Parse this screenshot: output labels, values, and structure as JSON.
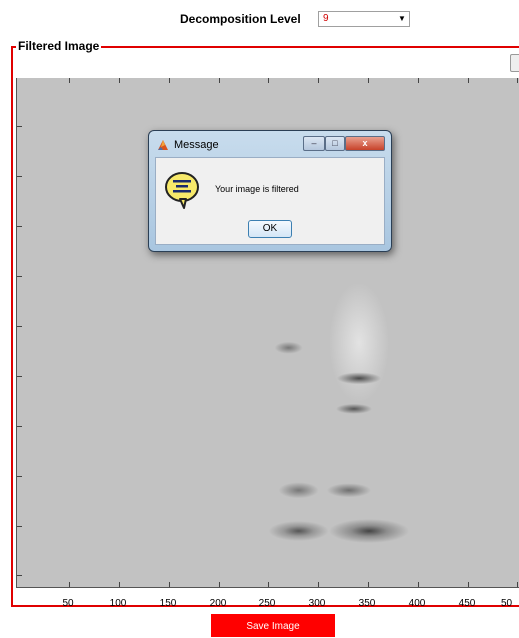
{
  "controls": {
    "decomposition_label": "Decomposition Level",
    "decomposition_value": "9"
  },
  "panel": {
    "title": "Filtered Image"
  },
  "axes": {
    "x_ticks": [
      "50",
      "100",
      "150",
      "200",
      "250",
      "300",
      "350",
      "400",
      "450",
      "50"
    ]
  },
  "dialog": {
    "title": "Message",
    "message": "Your image is filtered",
    "ok_label": "OK",
    "close_glyph": "x",
    "minimize_glyph": "–",
    "maximize_glyph": "□"
  },
  "toolbar": {
    "save_label": "Save Image"
  },
  "colors": {
    "accent": "#ff0000",
    "panel_border": "#e00000",
    "image_gray": "#c2c2c2"
  },
  "icons": [
    "chevron-down-icon",
    "matlab-icon",
    "info-speech-bubble-icon"
  ]
}
